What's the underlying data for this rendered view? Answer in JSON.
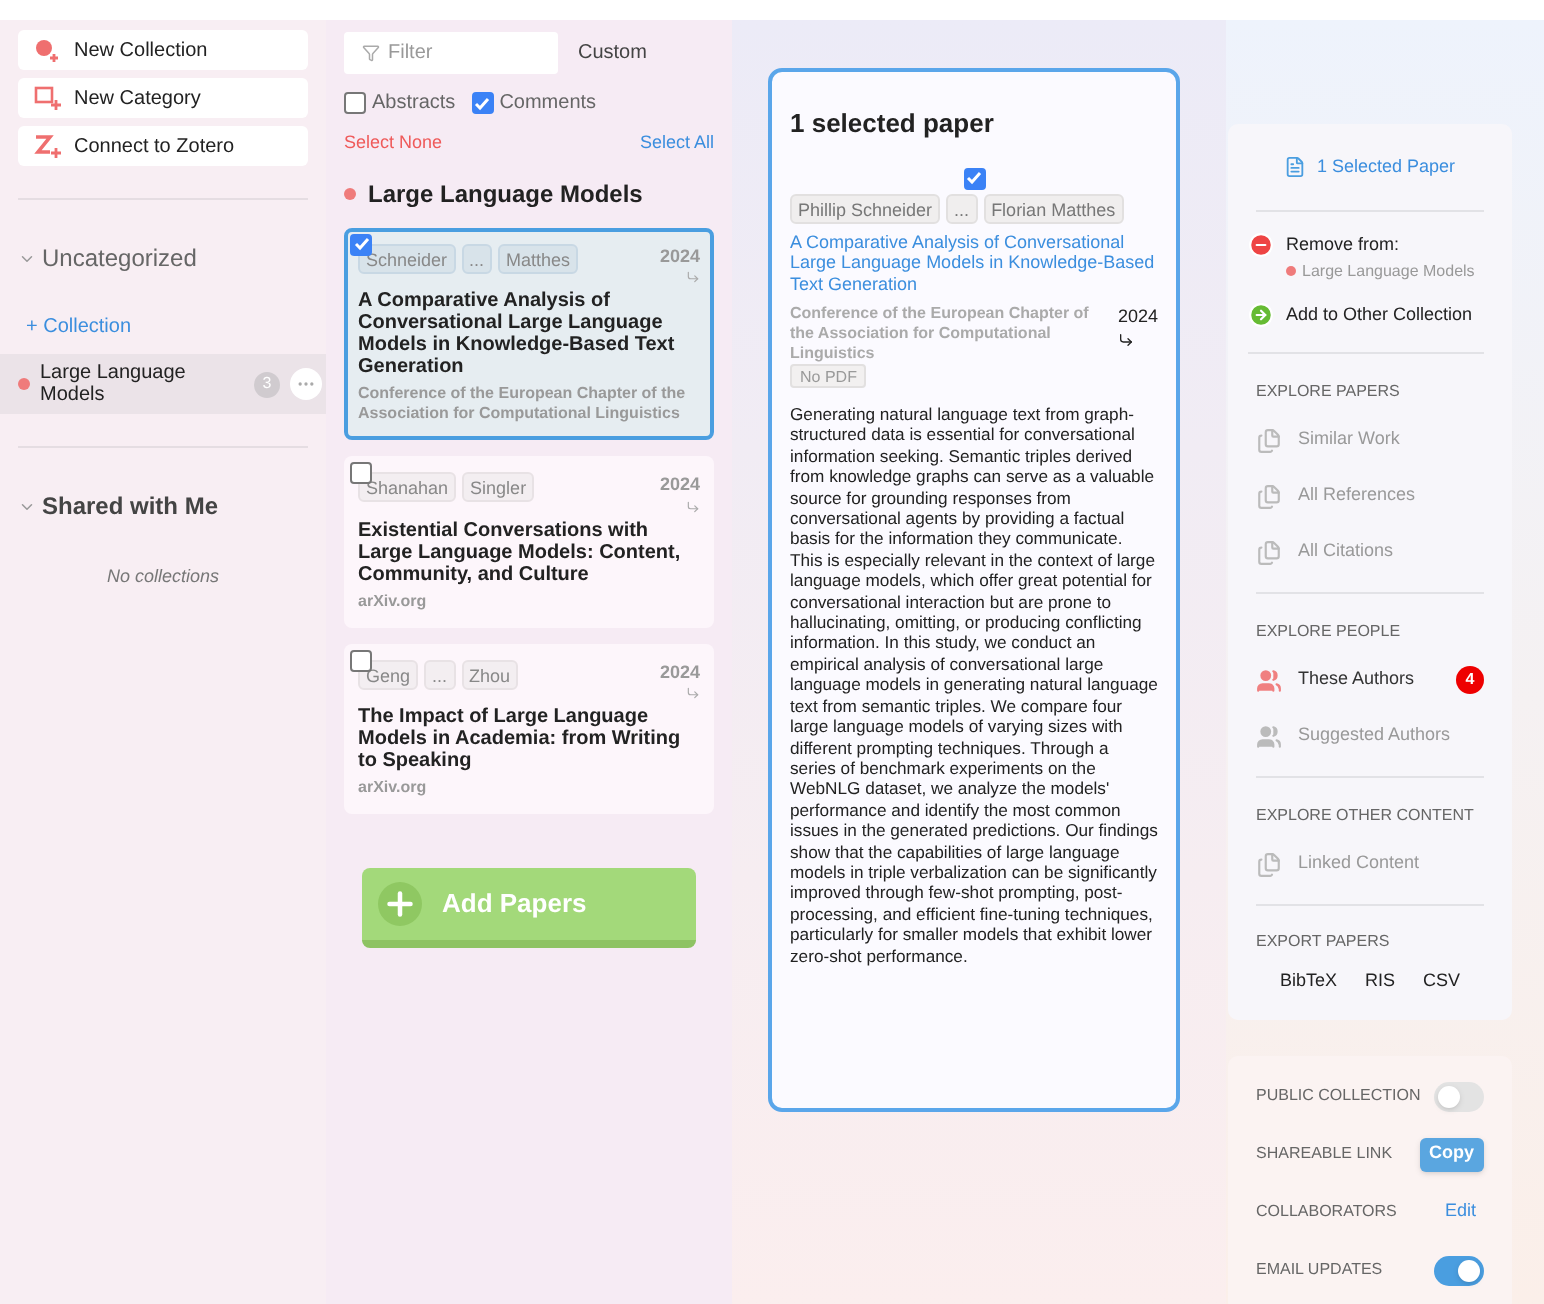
{
  "sidebar": {
    "actions": [
      {
        "label": "New Collection"
      },
      {
        "label": "New Category"
      },
      {
        "label": "Connect to Zotero"
      }
    ],
    "sections": [
      {
        "title": "Uncategorized",
        "expanded": true,
        "add_label": "+ Collection",
        "collections": [
          {
            "name": "Large Language Models",
            "color": "#ef7b7b",
            "count": "3",
            "selected": true
          }
        ]
      },
      {
        "title": "Shared with Me",
        "expanded": true,
        "empty": "No collections"
      }
    ]
  },
  "paper_list": {
    "filter": {
      "placeholder": "Filter"
    },
    "custom": "Custom",
    "toggles": [
      {
        "label": "Abstracts",
        "checked": false
      },
      {
        "label": "Comments",
        "checked": true
      }
    ],
    "select_none": "Select None",
    "select_all": "Select All",
    "collection": {
      "name": "Large Language Models",
      "color": "#ef7b7b"
    },
    "papers": [
      {
        "checked": true,
        "selected": true,
        "authors": [
          "Schneider",
          "...",
          "Matthes"
        ],
        "year": "2024",
        "title": "A Comparative Analysis of Conversational Large Language Models in Knowledge-Based Text Generation",
        "venue": "Conference of the European Chapter of the Association for Computational Linguistics"
      },
      {
        "checked": false,
        "selected": false,
        "authors": [
          "Shanahan",
          "Singler"
        ],
        "year": "2024",
        "title": "Existential Conversations with Large Language Models: Content, Community, and Culture",
        "venue": "arXiv.org"
      },
      {
        "checked": false,
        "selected": false,
        "authors": [
          "Geng",
          "...",
          "Zhou"
        ],
        "year": "2024",
        "title": "The Impact of Large Language Models in Academia: from Writing to Speaking",
        "venue": "arXiv.org"
      }
    ],
    "add_button": "Add Papers"
  },
  "detail": {
    "heading": "1 selected paper",
    "paper": {
      "checked": true,
      "authors": [
        "Phillip Schneider",
        "...",
        "Florian Matthes"
      ],
      "title": "A Comparative Analysis of Conversational Large Language Models in Knowledge-Based Text Generation",
      "venue": "Conference of the European Chapter of the Association for Computational Linguistics",
      "year": "2024",
      "pdf": "No PDF",
      "abstract": "Generating natural language text from graph-structured data is essential for conversational information seeking. Semantic triples derived from knowledge graphs can serve as a valuable source for grounding responses from conversational agents by providing a factual basis for the information they communicate. This is especially relevant in the context of large language models, which offer great potential for conversational interaction but are prone to hallucinating, omitting, or producing conflicting information. In this study, we conduct an empirical analysis of conversational large language models in generating natural language text from semantic triples. We compare four large language models of varying sizes with different prompting techniques. Through a series of benchmark experiments on the WebNLG dataset, we analyze the models' performance and identify the most common issues in the generated predictions. Our findings show that the capabilities of large language models in triple verbalization can be significantly improved through few-shot prompting, post-processing, and efficient fine-tuning techniques, particularly for smaller models that exhibit lower zero-shot performance."
    }
  },
  "actions_panel": {
    "header": "1 Selected Paper",
    "remove": {
      "label": "Remove from:",
      "collection": "Large Language Models",
      "color": "#ef7b7b"
    },
    "add_other": "Add to Other Collection",
    "sections": [
      {
        "title": "EXPLORE PAPERS",
        "items": [
          {
            "label": "Similar Work",
            "active": false
          },
          {
            "label": "All References",
            "active": false
          },
          {
            "label": "All Citations",
            "active": false
          }
        ]
      },
      {
        "title": "EXPLORE PEOPLE",
        "items": [
          {
            "label": "These Authors",
            "active": true,
            "badge": "4"
          },
          {
            "label": "Suggested Authors",
            "active": false
          }
        ]
      },
      {
        "title": "EXPLORE OTHER CONTENT",
        "items": [
          {
            "label": "Linked Content",
            "active": false
          }
        ]
      }
    ],
    "export": {
      "title": "EXPORT PAPERS",
      "formats": [
        "BibTeX",
        "RIS",
        "CSV"
      ]
    }
  },
  "settings": [
    {
      "label": "PUBLIC COLLECTION",
      "kind": "toggle",
      "on": false
    },
    {
      "label": "SHAREABLE LINK",
      "kind": "button",
      "value": "Copy"
    },
    {
      "label": "COLLABORATORS",
      "kind": "link",
      "value": "Edit"
    },
    {
      "label": "EMAIL UPDATES",
      "kind": "toggle",
      "on": true
    }
  ]
}
